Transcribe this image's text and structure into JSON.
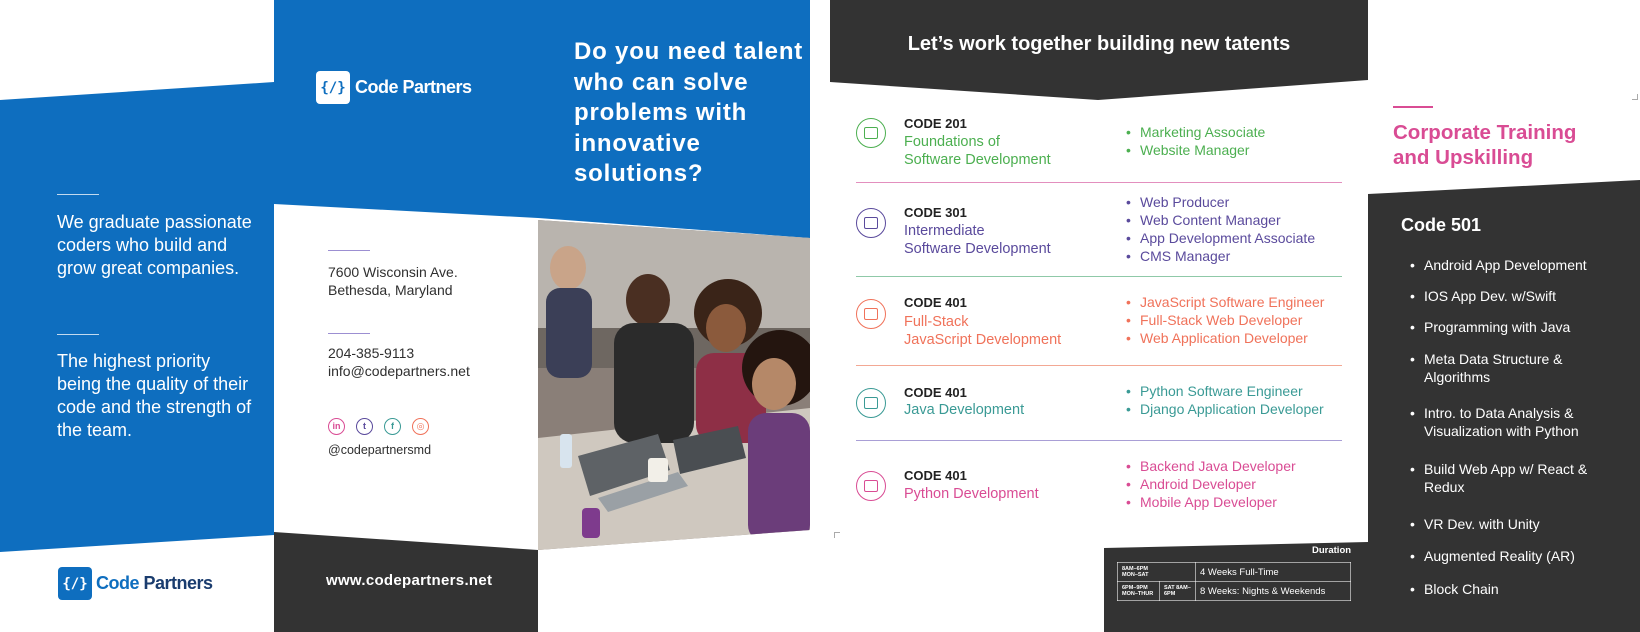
{
  "colors": {
    "brand_blue": "#0e6ebf",
    "dark": "#333333",
    "green": "#4caf50",
    "purple": "#5a4a9c",
    "salmon": "#f0725a",
    "teal": "#3a9a95",
    "pink": "#d94c94"
  },
  "brand": {
    "mark": "{/}",
    "name_part1": "Code",
    "name_part2": " Partners"
  },
  "panel1": {
    "text1": "We graduate passionate coders who build and grow great companies.",
    "text2": "The highest priority being the quality of their code and the strength of the team."
  },
  "panel2": {
    "headline": "Do you need talent who can solve problems with innovative solutions?",
    "address_line1": "7600 Wisconsin Ave.",
    "address_line2": "Bethesda, Maryland",
    "phone": "204-385-9113",
    "email": "info@codepartners.net",
    "socials": [
      {
        "icon": "linkedin-icon",
        "glyph": "in"
      },
      {
        "icon": "twitter-icon",
        "glyph": "t"
      },
      {
        "icon": "facebook-icon",
        "glyph": "f"
      },
      {
        "icon": "instagram-icon",
        "glyph": "◎"
      }
    ],
    "handle": "@codepartnersmd",
    "website": "www.codepartners.net"
  },
  "panel3": {
    "title": "Let’s work together building new tatents",
    "courses": [
      {
        "code": "CODE 201",
        "name_line1": "Foundations of",
        "name_line2": "Software Development",
        "roles": [
          "Marketing Associate",
          "Website Manager"
        ]
      },
      {
        "code": "CODE 301",
        "name_line1": "Intermediate",
        "name_line2": "Software Development",
        "roles": [
          "Web Producer",
          "Web Content Manager",
          "App Development Associate",
          "CMS Manager"
        ]
      },
      {
        "code": "CODE 401",
        "name_line1": "Full-Stack",
        "name_line2": "JavaScript Development",
        "roles": [
          "JavaScript Software Engineer",
          "Full-Stack Web Developer",
          "Web Application Developer"
        ]
      },
      {
        "code": "CODE 401",
        "name_line1": "Java Development",
        "name_line2": "",
        "roles": [
          "Python Software Engineer",
          "Django Application Developer"
        ]
      },
      {
        "code": "CODE 401",
        "name_line1": "Python Development",
        "name_line2": "",
        "roles": [
          "Backend Java Developer",
          "Android Developer",
          "Mobile App Developer"
        ]
      }
    ],
    "duration": {
      "label": "Duration",
      "rows": [
        {
          "time": "8AM–6PM",
          "days": "MON–SAT",
          "sat": "",
          "desc": "4 Weeks Full-Time"
        },
        {
          "time": "6PM–9PM",
          "days": "MON–THUR",
          "sat": "SAT 8AM–6PM",
          "desc": "8 Weeks: Nights & Weekends"
        }
      ]
    }
  },
  "panel4": {
    "title_line1": "Corporate Training",
    "title_line2": "and Upskilling",
    "heading": "Code 501",
    "items": [
      "Android App Development",
      "IOS App Dev. w/Swift",
      "Programming with Java",
      "Meta Data Structure & Algorithms",
      "Intro. to Data Analysis & Visualization with Python",
      "Build Web App w/ React & Redux",
      "VR Dev. with Unity",
      "Augmented Reality (AR)",
      "Block Chain"
    ]
  }
}
